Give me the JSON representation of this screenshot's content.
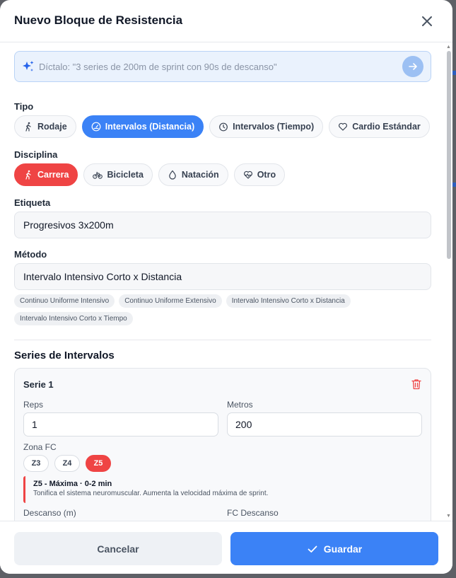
{
  "modal": {
    "title": "Nuevo Bloque de Resistencia"
  },
  "dictate": {
    "placeholder": "Díctalo: \"3 series de 200m de sprint con 90s de descanso\""
  },
  "tipo": {
    "label": "Tipo",
    "options": [
      {
        "label": "Rodaje",
        "icon": "runner-icon",
        "selected": false
      },
      {
        "label": "Intervalos (Distancia)",
        "icon": "gauge-icon",
        "selected": true
      },
      {
        "label": "Intervalos (Tiempo)",
        "icon": "timer-icon",
        "selected": false
      },
      {
        "label": "Cardio Estándar",
        "icon": "heart-icon",
        "selected": false
      }
    ]
  },
  "disciplina": {
    "label": "Disciplina",
    "options": [
      {
        "label": "Carrera",
        "icon": "runner-icon",
        "selected": true
      },
      {
        "label": "Bicicleta",
        "icon": "bicycle-icon",
        "selected": false
      },
      {
        "label": "Natación",
        "icon": "droplet-icon",
        "selected": false
      },
      {
        "label": "Otro",
        "icon": "heart-pulse-icon",
        "selected": false
      }
    ]
  },
  "etiqueta": {
    "label": "Etiqueta",
    "value": "Progresivos 3x200m"
  },
  "metodo": {
    "label": "Método",
    "value": "Intervalo Intensivo Corto x Distancia",
    "suggestions": [
      "Continuo Uniforme Intensivo",
      "Continuo Uniforme Extensivo",
      "Intervalo Intensivo Corto x Distancia",
      "Intervalo Intensivo Corto x Tiempo"
    ]
  },
  "series": {
    "title": "Series de Intervalos",
    "items": [
      {
        "title": "Serie 1",
        "reps_label": "Reps",
        "reps": "1",
        "metros_label": "Metros",
        "metros": "200",
        "zona_label": "Zona FC",
        "zones": [
          {
            "label": "Z3",
            "selected": false
          },
          {
            "label": "Z4",
            "selected": false
          },
          {
            "label": "Z5",
            "selected": true
          }
        ],
        "zone_title": "Z5 - Máxima · 0-2 min",
        "zone_desc": "Tonifica el sistema neuromuscular. Aumenta la velocidad máxima de sprint.",
        "descanso_label": "Descanso (m)",
        "fc_descanso_label": "FC Descanso"
      }
    ]
  },
  "footer": {
    "cancel": "Cancelar",
    "save": "Guardar"
  },
  "colors": {
    "primary": "#3b82f6",
    "danger": "#ef4444"
  }
}
